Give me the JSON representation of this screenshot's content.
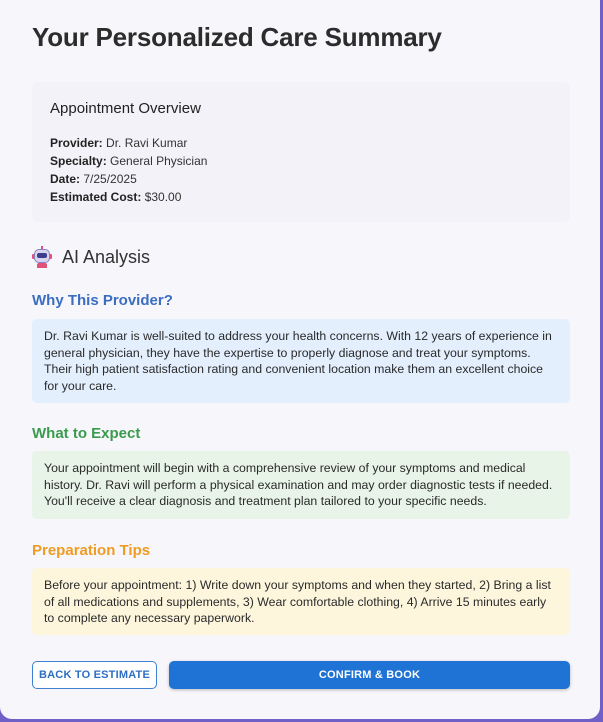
{
  "page": {
    "title": "Your Personalized Care Summary"
  },
  "overview": {
    "title": "Appointment Overview",
    "provider_label": "Provider:",
    "provider_value": "Dr. Ravi Kumar",
    "specialty_label": "Specialty:",
    "specialty_value": "General Physician",
    "date_label": "Date:",
    "date_value": "7/25/2025",
    "cost_label": "Estimated Cost:",
    "cost_value": "$30.00"
  },
  "ai": {
    "icon": "robot-icon",
    "title": "AI Analysis"
  },
  "sections": {
    "why": {
      "heading": "Why This Provider?",
      "body": "Dr. Ravi Kumar is well-suited to address your health concerns. With 12 years of experience in general physician, they have the expertise to properly diagnose and treat your symptoms. Their high patient satisfaction rating and convenient location make them an excellent choice for your care."
    },
    "expect": {
      "heading": "What to Expect",
      "body": "Your appointment will begin with a comprehensive review of your symptoms and medical history. Dr. Ravi will perform a physical examination and may order diagnostic tests if needed. You'll receive a clear diagnosis and treatment plan tailored to your specific needs."
    },
    "prep": {
      "heading": "Preparation Tips",
      "body": "Before your appointment: 1) Write down your symptoms and when they started, 2) Bring a list of all medications and supplements, 3) Wear comfortable clothing, 4) Arrive 15 minutes early to complete any necessary paperwork."
    }
  },
  "actions": {
    "back_label": "BACK TO ESTIMATE",
    "confirm_label": "CONFIRM & BOOK"
  },
  "colors": {
    "why_heading": "#3b6ec2",
    "expect_heading": "#3a9b4d",
    "prep_heading": "#ef9c22",
    "primary_button": "#1e73d4"
  }
}
